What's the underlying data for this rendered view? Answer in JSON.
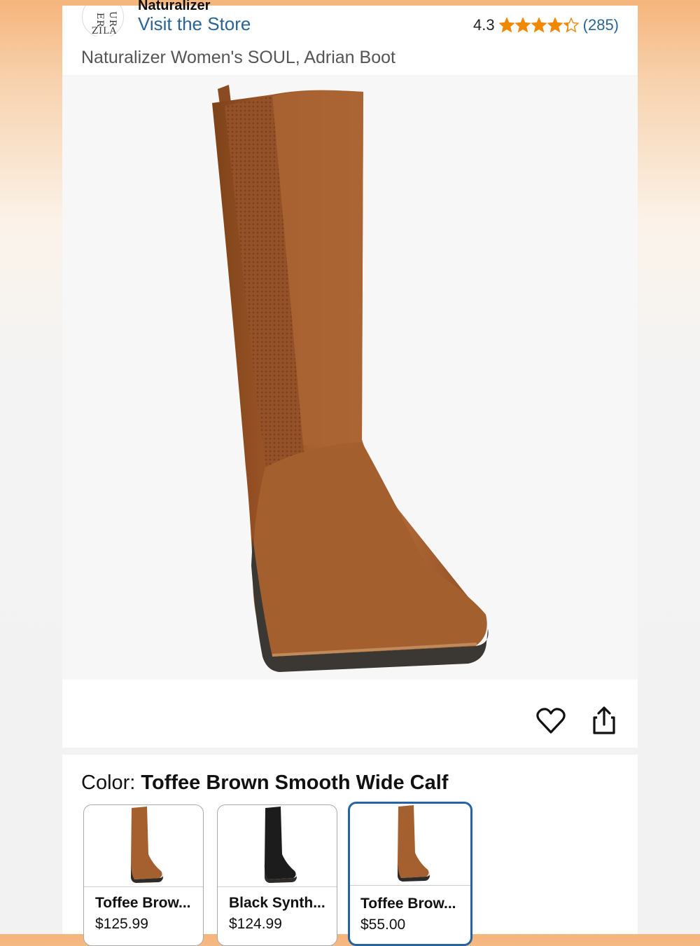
{
  "header": {
    "store_logo_text": "NATURALIZER",
    "store_name": "Naturalizer",
    "visit_store": "Visit the Store",
    "rating_value": "4.3",
    "rating_stars": 4.3,
    "rating_count": "(285)",
    "star_color": "#f08804"
  },
  "product": {
    "title": "Naturalizer Women's SOUL, Adrian Boot",
    "main_image": "tall-wedge-boot-image"
  },
  "actions": {
    "wishlist_icon": "heart-icon",
    "share_icon": "share-icon"
  },
  "variants": {
    "color_label": "Color: ",
    "selected_color": "Toffee Brown Smooth Wide Calf",
    "selected_border_color": "#2463a6",
    "items": [
      {
        "name": "Toffee Brow...",
        "price": "$125.99",
        "color": "#a4602f",
        "selected": false
      },
      {
        "name": "Black Synth...",
        "price": "$124.99",
        "color": "#1c1c1c",
        "selected": false
      },
      {
        "name": "Toffee Brow...",
        "price": "$55.00",
        "color": "#a4602f",
        "selected": true
      }
    ]
  }
}
